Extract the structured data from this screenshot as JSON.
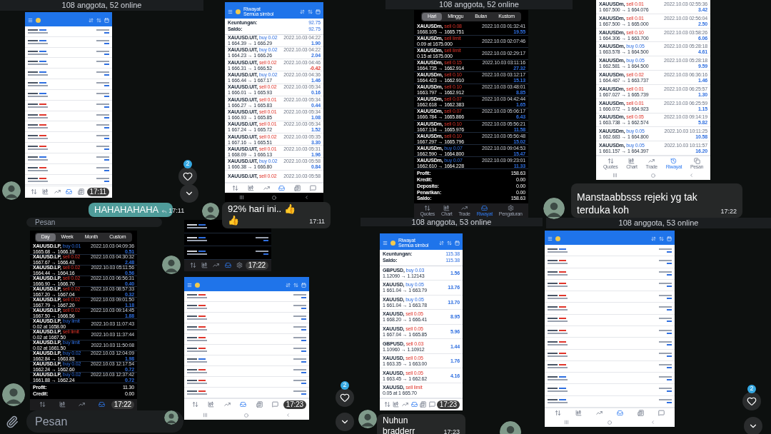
{
  "chat_headers": [
    {
      "text": "108 anggota, 52 online"
    },
    {
      "text": "108 anggota, 52 online"
    },
    {
      "text": "108 anggota, 53 online"
    },
    {
      "text": "108 anggota, 53 online"
    }
  ],
  "phones": [
    {
      "dark": false,
      "trades": [
        {
          "buy": true
        },
        {
          "buy": true
        },
        {
          "buy": true
        },
        {
          "buy": true
        },
        {
          "buy": true
        },
        {
          "buy": true
        },
        {
          "buy": true
        },
        {
          "buy": false
        },
        {
          "buy": false
        },
        {
          "buy": false
        },
        {
          "buy": false
        },
        {
          "buy": false
        },
        {
          "buy": true
        },
        {
          "buy": false
        },
        {
          "buy": false
        }
      ],
      "nav": [
        {
          "selected": false
        },
        {
          "selected": false
        },
        {
          "selected": false
        },
        {
          "selected": true
        },
        {
          "selected": false
        }
      ],
      "time": "17:11"
    },
    {
      "dark": false,
      "title": "Riwayat",
      "subtitle": "Semua simbol",
      "summary": [
        {
          "label": "Keuntungan:",
          "value": "92.75"
        },
        {
          "label": "Saldo:",
          "value": "92.75"
        }
      ],
      "trades": [
        {
          "symbol": "XAUUSD.UIT,",
          "side": "buy 0.02",
          "buy": true,
          "prices": "1 664.39 → 1 666.29",
          "date": "2022.10.03 04:22",
          "profit": "1.90"
        },
        {
          "symbol": "XAUUSD.UIT,",
          "side": "buy 0.02",
          "buy": true,
          "prices": "1 664.23 → 1 666.26",
          "date": "2022.10.03 04:22",
          "profit": "2.04"
        },
        {
          "symbol": "XAUUSD.UIT,",
          "side": "sell 0.02",
          "buy": false,
          "prices": "1 666.31 → 1 666.52",
          "date": "2022.10.03 04:46",
          "profit": "-0.42"
        },
        {
          "symbol": "XAUUSD.UIT,",
          "side": "buy 0.02",
          "buy": true,
          "prices": "1 666.44 → 1 667.17",
          "date": "2022.10.03 04:36",
          "profit": "1.46"
        },
        {
          "symbol": "XAUUSD.UIT,",
          "side": "sell 0.02",
          "buy": false,
          "prices": "1 666.01 → 1 665.93",
          "date": "2022.10.03 05:34",
          "profit": "0.16"
        },
        {
          "symbol": "XAUUSD.UIT,",
          "side": "sell 0.01",
          "buy": false,
          "prices": "1 666.27 → 1 665.83",
          "date": "2022.10.03 05:34",
          "profit": "0.44"
        },
        {
          "symbol": "XAUUSD.UIT,",
          "side": "sell 0.01",
          "buy": false,
          "prices": "1 666.93 → 1 665.85",
          "date": "2022.10.03 05:34",
          "profit": "1.08"
        },
        {
          "symbol": "XAUUSD.UIT,",
          "side": "sell 0.01",
          "buy": false,
          "prices": "1 667.24 → 1 665.72",
          "date": "2022.10.03 05:34",
          "profit": "1.52"
        },
        {
          "symbol": "XAUUSD.UIT,",
          "side": "sell 0.02",
          "buy": false,
          "prices": "1 667.16 → 1 665.51",
          "date": "2022.10.03 05:35",
          "profit": "3.30"
        },
        {
          "symbol": "XAUUSD.UIT,",
          "side": "sell 0.01",
          "buy": false,
          "prices": "1 668.09 → 1 666.13",
          "date": "2022.10.03 05:31",
          "profit": "1.96"
        },
        {
          "symbol": "XAUUSD.UIT,",
          "side": "buy 0.02",
          "buy": true,
          "prices": "1 666.38 → 1 666.80",
          "date": "2022.10.03 05:58",
          "profit": "0.84"
        },
        {
          "symbol": "XAUUSD.UIT,",
          "side": "sell 0.02",
          "buy": false,
          "date": "2022.10.03 05:58"
        }
      ],
      "nav": [
        {
          "selected": false
        },
        {
          "selected": false
        },
        {
          "selected": false
        },
        {
          "selected": true
        },
        {
          "selected": false
        },
        {
          "selected": false
        }
      ]
    },
    {
      "dark": true,
      "tabs": [
        {
          "label": "Hari",
          "selected": true
        },
        {
          "label": "Minggu",
          "selected": false
        },
        {
          "label": "Bulan",
          "selected": false
        },
        {
          "label": "Kustom",
          "selected": false
        }
      ],
      "trades": [
        {
          "symbol": "XAUUSDm,",
          "side": "sell 0.08",
          "buy": false,
          "prices": "1668.105 → 1665.751",
          "date": "2022.10.03 01:32:41",
          "profit": "19.55"
        },
        {
          "symbol": "XAUUSDm,",
          "side": "sell limit",
          "buy": false,
          "prices": "0.09 at 1675.000",
          "date": "2022.10.03 02:07:46"
        },
        {
          "symbol": "XAUUSDm,",
          "side": "sell limit",
          "buy": false,
          "prices": "0.15 at 1675.000",
          "date": "2022.10.03 02:29:17"
        },
        {
          "symbol": "XAUUSDm,",
          "side": "sell 0.15",
          "buy": false,
          "prices": "1664.735 → 1662.914",
          "date": "2022.10.03 03:11:16",
          "profit": "27.32"
        },
        {
          "symbol": "XAUUSDm,",
          "side": "sell 0.10",
          "buy": false,
          "prices": "1664.423 → 1662.910",
          "date": "2022.10.03 03:12:17",
          "profit": "15.13"
        },
        {
          "symbol": "XAUUSDm,",
          "side": "sell 0.10",
          "buy": false,
          "prices": "1663.797 → 1662.912",
          "date": "2022.10.03 03:48:01",
          "profit": "8.85"
        },
        {
          "symbol": "XAUUSDm,",
          "side": "sell 0.07",
          "buy": false,
          "prices": "1662.618 → 1662.383",
          "date": "2022.10.03 04:42:44",
          "profit": "1.65"
        },
        {
          "symbol": "XAUUSDm,",
          "side": "sell 0.07",
          "buy": false,
          "prices": "1666.784 → 1665.866",
          "date": "2022.10.03 05:06:17",
          "profit": "6.43"
        },
        {
          "symbol": "XAUUSDm,",
          "side": "sell 0.10",
          "buy": false,
          "prices": "1667.134 → 1665.976",
          "date": "2022.10.03 05:56:21",
          "profit": "11.58"
        },
        {
          "symbol": "XAUUSDm,",
          "side": "sell 0.10",
          "buy": false,
          "prices": "1667.297 → 1665.796",
          "date": "2022.10.03 05:56:48",
          "profit": "15.02"
        },
        {
          "symbol": "XAUUSDm,",
          "side": "buy 0.07",
          "buy": true,
          "prices": "1662.590 → 1664.800",
          "date": "2022.10.03 09:04:53",
          "profit": "15.47"
        },
        {
          "symbol": "XAUUSDm,",
          "side": "buy 0.07",
          "buy": true,
          "prices": "1662.610 → 1664.228",
          "date": "2022.10.03 09:23:01",
          "profit": "11.33"
        }
      ],
      "summary": [
        {
          "label": "Profit:",
          "value": "158.63"
        },
        {
          "label": "Kredit:",
          "value": "0.00"
        },
        {
          "label": "Deposito:",
          "value": "0.00"
        },
        {
          "label": "Penarikan:",
          "value": "0.00"
        },
        {
          "label": "Saldo:",
          "value": "158.63"
        }
      ],
      "nav": [
        {
          "label": "Quotes",
          "selected": false
        },
        {
          "label": "Chart",
          "selected": false
        },
        {
          "label": "Trade",
          "selected": false
        },
        {
          "label": "Riwayat",
          "selected": true
        },
        {
          "label": "Pengaturan",
          "selected": false
        }
      ]
    },
    {
      "dark": false,
      "trades": [
        {
          "symbol": "XAUUSDm,",
          "side": "sell 0.01",
          "buy": false,
          "prices": "1 667.500 → 1 664.076",
          "date": "2022.10.03 02:55:36",
          "profit": "3.42"
        },
        {
          "symbol": "XAUUSDm,",
          "side": "sell 0.01",
          "buy": false,
          "prices": "1 667.500 → 1 665.000",
          "date": "2022.10.03 02:56:04",
          "profit": "2.50"
        },
        {
          "symbol": "XAUUSDm,",
          "side": "sell 0.10",
          "buy": false,
          "prices": "1 664.306 → 1 663.700",
          "date": "2022.10.03 03:58:26",
          "profit": "6.06"
        },
        {
          "symbol": "XAUUSDm,",
          "side": "buy 0.05",
          "buy": true,
          "prices": "1 663.578 → 1 664.500",
          "date": "2022.10.03 05:28:18",
          "profit": "4.61"
        },
        {
          "symbol": "XAUUSDm,",
          "side": "buy 0.05",
          "buy": true,
          "prices": "1 662.581 → 1 664.500",
          "date": "2022.10.03 05:28:18",
          "profit": "9.59"
        },
        {
          "symbol": "XAUUSDm,",
          "side": "sell 0.02",
          "buy": false,
          "prices": "1 664.467 → 1 663.737",
          "date": "2022.10.03 06:36:16",
          "profit": "1.46"
        },
        {
          "symbol": "XAUUSDm,",
          "side": "sell 0.01",
          "buy": false,
          "prices": "1 667.027 → 1 665.739",
          "date": "2022.10.03 06:25:57",
          "profit": "1.30"
        },
        {
          "symbol": "XAUUSDm,",
          "side": "sell 0.01",
          "buy": false,
          "prices": "1 666.072 → 1 664.923",
          "date": "2022.10.03 06:25:59",
          "profit": "1.15"
        },
        {
          "symbol": "XAUUSDm,",
          "side": "sell 0.05",
          "buy": false,
          "prices": "1 663.738 → 1 662.574",
          "date": "2022.10.03 09:14:19",
          "profit": "5.82"
        },
        {
          "symbol": "XAUUSDm,",
          "side": "buy 0.05",
          "buy": true,
          "prices": "1 662.683 → 1 664.800",
          "date": "2022.10.03 10:11:25",
          "profit": "10.58"
        },
        {
          "symbol": "XAUUSDm,",
          "side": "buy 0.05",
          "buy": true,
          "prices": "1 661.157 → 1 664.397",
          "date": "2022.10.03 10:11:57",
          "profit": "16.20"
        }
      ],
      "nav": [
        {
          "label": "Quotes",
          "selected": false
        },
        {
          "label": "Chart",
          "selected": false
        },
        {
          "label": "Trade",
          "selected": false
        },
        {
          "label": "Riwayat",
          "selected": true
        },
        {
          "label": "Pesan",
          "selected": false
        }
      ]
    },
    {
      "dark": true,
      "tabs": [
        {
          "label": "Day",
          "selected": true
        },
        {
          "label": "Week",
          "selected": false
        },
        {
          "label": "Month",
          "selected": false
        },
        {
          "label": "Custom",
          "selected": false
        }
      ],
      "trades": [
        {
          "symbol": "XAUUSD.LP,",
          "side": "buy 0.01",
          "buy": true,
          "prices": "1665.68 → 1666.19",
          "date": "2022.10.03 04:09:36",
          "profit": "0.51"
        },
        {
          "symbol": "XAUUSD.LP,",
          "side": "sell 0.02",
          "buy": false,
          "prices": "1667.67 → 1666.43",
          "date": "2022.10.03 04:30:32",
          "profit": "2.48"
        },
        {
          "symbol": "XAUUSD.LP,",
          "side": "sell 0.02",
          "buy": false,
          "prices": "1664.44 → 1664.16",
          "date": "2022.10.03 05:11:56",
          "profit": "0.56"
        },
        {
          "symbol": "XAUUSD.LP,",
          "side": "sell 0.02",
          "buy": false,
          "prices": "1666.90 → 1666.70",
          "date": "2022.10.03 06:56:31",
          "profit": "0.40"
        },
        {
          "symbol": "XAUUSD.LP,",
          "side": "sell 0.02",
          "buy": false,
          "prices": "1667.20 → 1667.04",
          "date": "2022.10.03 08:57:33",
          "profit": "0.32"
        },
        {
          "symbol": "XAUUSD.LP,",
          "side": "sell 0.02",
          "buy": false,
          "prices": "1667.79 → 1667.20",
          "date": "2022.10.03 09:01:50",
          "profit": "1.18"
        },
        {
          "symbol": "XAUUSD.LP,",
          "side": "sell 0.02",
          "buy": false,
          "prices": "1667.50 → 1666.56",
          "date": "2022.10.03 09:14:45",
          "profit": "1.88"
        },
        {
          "symbol": "XAUUSD.LP,",
          "side": "buy limit",
          "buy": true,
          "prices": "0.02 at 1658.00",
          "date": "2022.10.03 11:07:43"
        },
        {
          "symbol": "XAUUSD.LP,",
          "side": "sell limit",
          "buy": false,
          "prices": "0.02 at 1667.50",
          "date": "2022.10.03 11:37:44"
        },
        {
          "symbol": "XAUUSD.LP,",
          "side": "buy limit",
          "buy": true,
          "prices": "0.02 at 1661.50",
          "date": "2022.10.03 11:50:08"
        },
        {
          "symbol": "XAUUSD.LP,",
          "side": "buy 0.02",
          "buy": true,
          "prices": "1662.84 → 1663.83",
          "date": "2022.10.03 12:04:09",
          "profit": "1.98"
        },
        {
          "symbol": "XAUUSD.LP,",
          "side": "buy 0.02",
          "buy": true,
          "prices": "1662.24 → 1662.60",
          "date": "2022.10.03 12:17:54",
          "profit": "0.72"
        },
        {
          "symbol": "XAUUSD.LP,",
          "side": "buy 0.02",
          "buy": true,
          "prices": "1661.88 → 1662.24",
          "date": "2022.10.03 12:37:42",
          "profit": "0.72"
        }
      ],
      "summary": [
        {
          "label": "Profit:",
          "value": "11.30"
        },
        {
          "label": "Credit:",
          "value": "0.00"
        }
      ],
      "nav": [
        {
          "selected": false
        },
        {
          "selected": false
        },
        {
          "selected": false
        },
        {
          "selected": true
        }
      ],
      "time": "17:22"
    },
    {
      "dark": true,
      "trades": [
        {
          "buy": true
        },
        {
          "buy": true
        },
        {
          "buy": true
        }
      ],
      "nav": [
        {
          "selected": false
        },
        {
          "selected": false
        },
        {
          "selected": false
        },
        {
          "selected": true
        },
        {
          "selected": false
        }
      ],
      "time": "17:22"
    },
    {
      "dark": false,
      "trades": [
        {
          "buy": false
        },
        {
          "buy": false
        },
        {
          "buy": false
        },
        {
          "buy": false
        },
        {
          "buy": false
        },
        {
          "buy": false
        },
        {
          "buy": true
        },
        {
          "buy": false
        },
        {
          "buy": false
        },
        {
          "buy": false
        }
      ],
      "nav": [
        {
          "selected": false
        },
        {
          "selected": false
        },
        {
          "selected": false
        },
        {
          "selected": true
        },
        {
          "selected": false
        },
        {
          "selected": false
        }
      ],
      "time": "17:23"
    },
    {
      "dark": false,
      "title": "Riwayat",
      "subtitle": "Semua simbol",
      "summary": [
        {
          "label": "Keuntungan:",
          "value": "115.38"
        },
        {
          "label": "Saldo:",
          "value": "115.38"
        }
      ],
      "trades": [
        {
          "symbol": "GBPUSD,",
          "side": "buy 0.03",
          "buy": true,
          "prices": "1.12090 → 1.12143",
          "profit": "1.56"
        },
        {
          "symbol": "XAUUSD,",
          "side": "buy 0.05",
          "buy": true,
          "prices": "1 661.04 → 1 663.79",
          "profit": "13.76"
        },
        {
          "symbol": "XAUUSD,",
          "side": "buy 0.05",
          "buy": true,
          "prices": "1 661.04 → 1 663.78",
          "profit": "13.70"
        },
        {
          "symbol": "XAUUSD,",
          "side": "sell 0.05",
          "buy": false,
          "prices": "1 668.20 → 1 666.41",
          "profit": "8.95"
        },
        {
          "symbol": "XAUUSD,",
          "side": "sell 0.05",
          "buy": false,
          "prices": "1 667.04 → 1 665.85",
          "profit": "5.96"
        },
        {
          "symbol": "GBPUSD,",
          "side": "sell 0.03",
          "buy": false,
          "prices": "1.10960 → 1.10912",
          "profit": "1.44"
        },
        {
          "symbol": "XAUUSD,",
          "side": "sell 0.05",
          "buy": false,
          "prices": "1 663.35 → 1 663.00",
          "profit": "1.76"
        },
        {
          "symbol": "XAUUSD,",
          "side": "sell 0.05",
          "buy": false,
          "prices": "1 663.45 → 1 662.62",
          "profit": "4.16"
        },
        {
          "symbol": "XAUUSD,",
          "side": "sell limit",
          "buy": false,
          "prices": "0.05 at 1 665.70"
        }
      ],
      "nav": [
        {
          "selected": false
        },
        {
          "selected": false
        },
        {
          "selected": false
        },
        {
          "selected": true
        },
        {
          "selected": false
        },
        {
          "selected": false
        }
      ],
      "time": "17:23"
    },
    {
      "dark": false,
      "trades": [
        {
          "buy": true
        },
        {
          "buy": false
        },
        {
          "buy": false
        },
        {
          "buy": false
        },
        {
          "buy": false
        },
        {
          "buy": false
        },
        {
          "buy": false
        },
        {
          "buy": false
        },
        {
          "buy": false
        },
        {
          "buy": false
        },
        {
          "buy": false
        },
        {
          "buy": true
        },
        {
          "buy": true
        },
        {
          "buy": true
        }
      ],
      "nav": [
        {
          "selected": false
        },
        {
          "selected": false
        },
        {
          "selected": false
        },
        {
          "selected": true
        },
        {
          "selected": false
        },
        {
          "selected": false
        }
      ]
    }
  ],
  "messages": [
    {
      "text": "HAHAHAHAHA",
      "time": "17:11",
      "outgoing": true
    },
    {
      "text": "92% hari ini.. 👍👍",
      "time": "17:11",
      "outgoing": false
    },
    {
      "text": "Manstaabbsss rejeki yg tak terduka koh",
      "time": "17:22",
      "outgoing": false
    },
    {
      "text": "Nuhun bradderr",
      "time": "17:23",
      "outgoing": false
    }
  ],
  "reactions": [
    {
      "count": "2"
    },
    {
      "count": "2"
    },
    {
      "count": "2"
    }
  ],
  "inputs": [
    {
      "placeholder": "Pesan"
    },
    {
      "placeholder": "Pesan"
    }
  ]
}
